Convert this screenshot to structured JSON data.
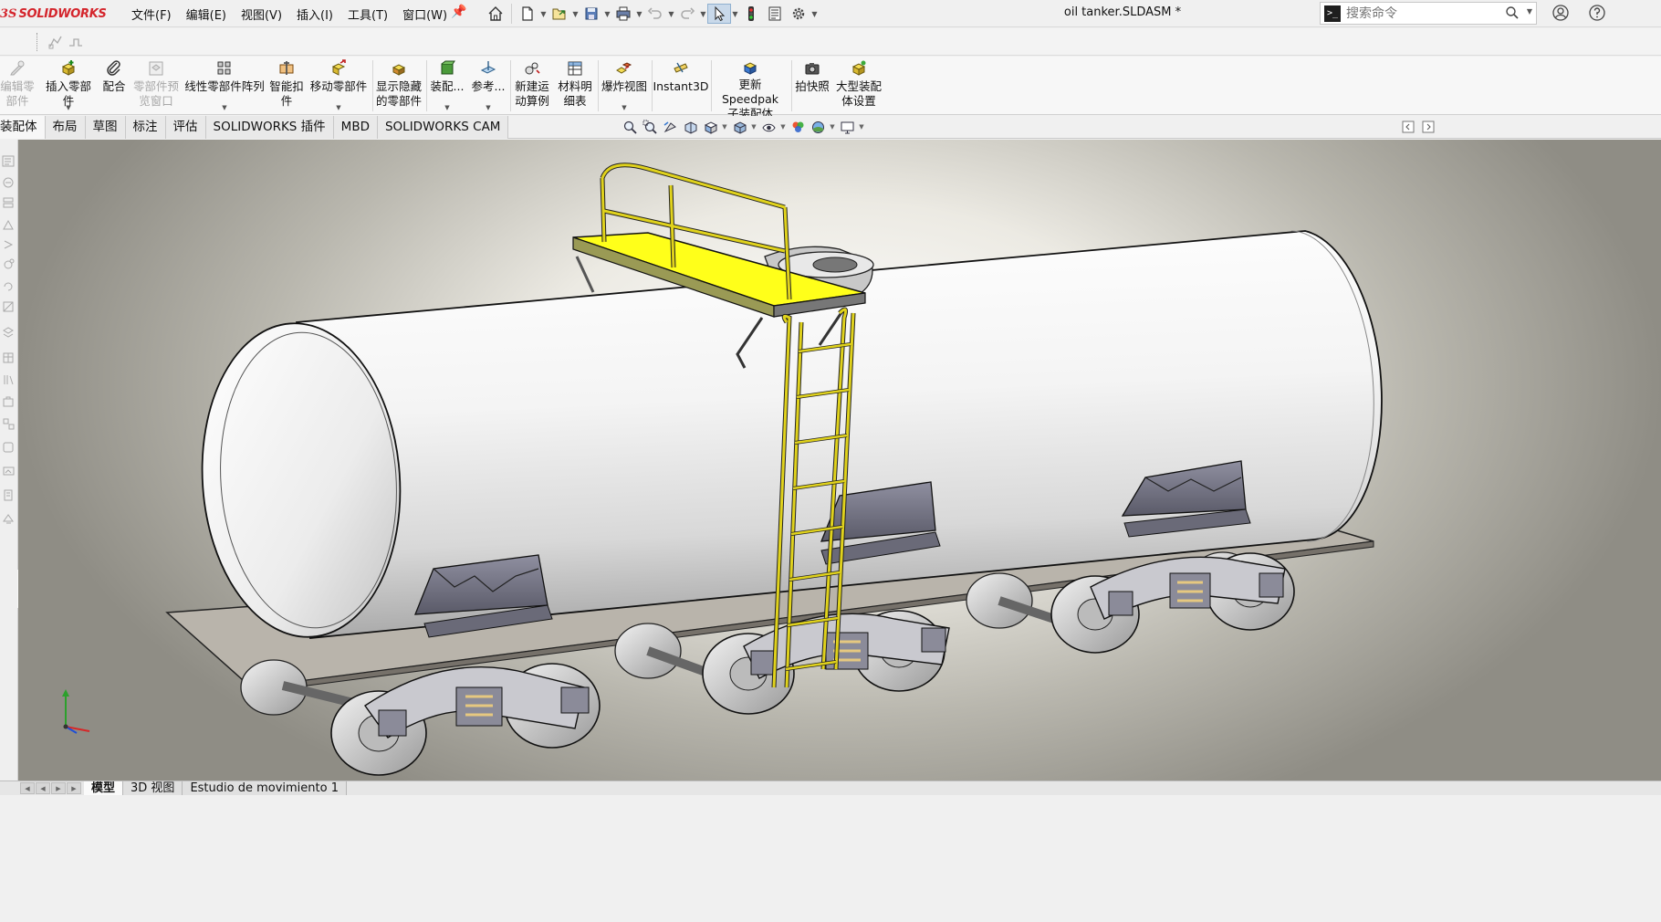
{
  "app": {
    "logo_prefix": "3S",
    "logo_name": "SOLIDWORKS",
    "document_title": "oil tanker.SLDASM *"
  },
  "menu": {
    "items": [
      "文件(F)",
      "编辑(E)",
      "视图(V)",
      "插入(I)",
      "工具(T)",
      "窗口(W)"
    ]
  },
  "search": {
    "placeholder": "搜索命令"
  },
  "ribbon": {
    "commands": [
      {
        "label": "编辑零\n部件",
        "enabled": false
      },
      {
        "label": "插入零部件",
        "enabled": true
      },
      {
        "label": "配合",
        "enabled": true
      },
      {
        "label": "零部件预\n览窗口",
        "enabled": false
      },
      {
        "label": "线性零部件阵列",
        "enabled": true
      },
      {
        "label": "智能扣\n件",
        "enabled": true
      },
      {
        "label": "移动零部件",
        "enabled": true
      },
      {
        "label": "显示隐藏\n的零部件",
        "enabled": true
      },
      {
        "label": "装配...",
        "enabled": true
      },
      {
        "label": "参考...",
        "enabled": true
      },
      {
        "label": "新建运\n动算例",
        "enabled": true
      },
      {
        "label": "材料明\n细表",
        "enabled": true
      },
      {
        "label": "爆炸视图",
        "enabled": true
      },
      {
        "label": "Instant3D",
        "enabled": true
      },
      {
        "label": "更新 Speedpak\n子装配体",
        "enabled": true
      },
      {
        "label": "拍快照",
        "enabled": true
      },
      {
        "label": "大型装配\n体设置",
        "enabled": true
      }
    ]
  },
  "tabs": {
    "items": [
      "装配体",
      "布局",
      "草图",
      "标注",
      "评估",
      "SOLIDWORKS 插件",
      "MBD",
      "SOLIDWORKS CAM"
    ],
    "active": "装配体"
  },
  "bottom_tabs": {
    "items": [
      "模型",
      "3D 视图",
      "Estudio de movimiento 1"
    ],
    "active": "模型"
  },
  "colors": {
    "accent_red": "#d4252c",
    "platform_yellow": "#ffff1a",
    "rail_yellow": "#e0d21c",
    "tank_white": "#f4f4f4",
    "bogie_gray": "#9a9aa2"
  },
  "icons": {
    "quick_access": [
      "home-icon",
      "new-document-icon",
      "open-icon",
      "save-icon",
      "print-icon",
      "undo-icon",
      "redo-icon",
      "select-arrow-icon",
      "traffic-light-icon",
      "file-properties-icon",
      "options-gear-icon"
    ],
    "view_tools": [
      "zoom-to-fit-icon",
      "zoom-to-area-icon",
      "previous-view-icon",
      "section-view-icon",
      "view-orientation-icon",
      "display-style-icon",
      "hide-show-items-icon",
      "edit-appearance-icon",
      "apply-scene-icon",
      "view-settings-icon"
    ]
  }
}
